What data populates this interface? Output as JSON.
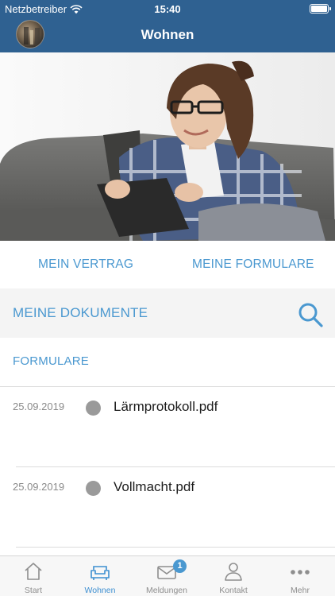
{
  "status_bar": {
    "carrier": "Netzbetreiber",
    "time": "15:40"
  },
  "header": {
    "title": "Wohnen"
  },
  "segments": {
    "left": "MEIN VERTRAG",
    "right": "MEINE FORMULARE"
  },
  "documents": {
    "title": "MEINE DOKUMENTE",
    "section": "FORMULARE",
    "items": [
      {
        "date": "25.09.2019",
        "name": "Lärmprotokoll.pdf"
      },
      {
        "date": "25.09.2019",
        "name": "Vollmacht.pdf"
      }
    ]
  },
  "tabbar": {
    "tabs": [
      {
        "label": "Start",
        "icon": "home-icon"
      },
      {
        "label": "Wohnen",
        "icon": "sofa-icon"
      },
      {
        "label": "Meldungen",
        "icon": "mail-icon",
        "badge": "1"
      },
      {
        "label": "Kontakt",
        "icon": "person-icon"
      },
      {
        "label": "Mehr",
        "icon": "more-icon"
      }
    ],
    "active": "Wohnen"
  },
  "colors": {
    "header": "#2f6191",
    "accent": "#4a98d0",
    "dot": "#9a9a9a"
  }
}
